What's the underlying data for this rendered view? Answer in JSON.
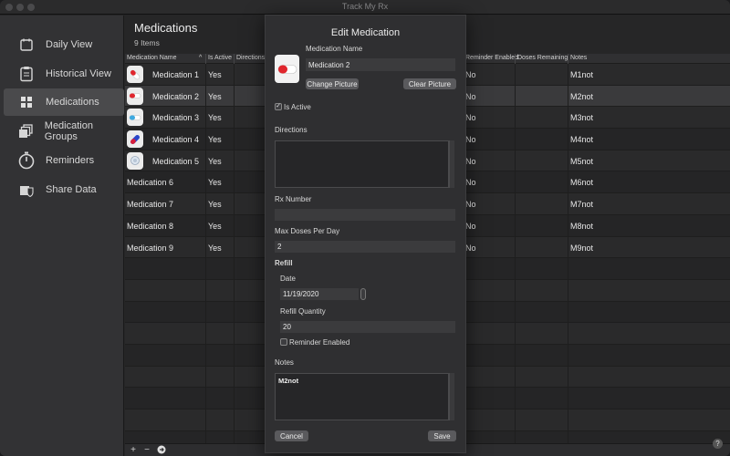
{
  "window": {
    "title": "Track My Rx"
  },
  "sidebar": {
    "items": [
      {
        "label": "Daily View",
        "icon": "calendar-icon",
        "active": false
      },
      {
        "label": "Historical View",
        "icon": "clipboard-icon",
        "active": false
      },
      {
        "label": "Medications",
        "icon": "grid-icon",
        "active": true
      },
      {
        "label": "Medication Groups",
        "icon": "stacked-squares-icon",
        "active": false
      },
      {
        "label": "Reminders",
        "icon": "stopwatch-icon",
        "active": false
      },
      {
        "label": "Share Data",
        "icon": "share-shield-icon",
        "active": false
      }
    ]
  },
  "main": {
    "title": "Medications",
    "count": "9 Items",
    "columns": {
      "name": "Medication Name",
      "sort": "^",
      "active": "Is Active",
      "directions": "Directions",
      "reminder": "Reminder Enabled",
      "doses": "Doses Remaining",
      "notes": "Notes"
    },
    "rows": [
      {
        "name": "Medication 1",
        "active": "Yes",
        "reminder": "No",
        "notes": "M1not",
        "pill": "red-white-capsule"
      },
      {
        "name": "Medication 2",
        "active": "Yes",
        "reminder": "No",
        "notes": "M2not",
        "pill": "red-white-pill"
      },
      {
        "name": "Medication 3",
        "active": "Yes",
        "reminder": "No",
        "notes": "M3not",
        "pill": "blue-white-pill"
      },
      {
        "name": "Medication 4",
        "active": "Yes",
        "reminder": "No",
        "notes": "M4not",
        "pill": "blue-red-capsule"
      },
      {
        "name": "Medication 5",
        "active": "Yes",
        "reminder": "No",
        "notes": "M5not",
        "pill": "round-tablet"
      },
      {
        "name": "Medication 6",
        "active": "Yes",
        "reminder": "No",
        "notes": "M6not"
      },
      {
        "name": "Medication 7",
        "active": "Yes",
        "reminder": "No",
        "notes": "M7not"
      },
      {
        "name": "Medication 8",
        "active": "Yes",
        "reminder": "No",
        "notes": "M8not"
      },
      {
        "name": "Medication 9",
        "active": "Yes",
        "reminder": "No",
        "notes": "M9not"
      }
    ],
    "bottom": {
      "add": "+",
      "remove": "−",
      "more": "●",
      "help": "?"
    }
  },
  "sheet": {
    "title": "Edit Medication",
    "name_label": "Medication Name",
    "name_value": "Medication 2",
    "change_picture": "Change Picture",
    "clear_picture": "Clear Picture",
    "is_active_label": "Is Active",
    "is_active_mark": "✓",
    "directions_label": "Directions",
    "directions_value": "",
    "rx_label": "Rx Number",
    "rx_value": "",
    "max_doses_label": "Max Doses Per Day",
    "max_doses_value": "2",
    "refill_label": "Refill",
    "date_label": "Date",
    "date_value": "11/19/2020",
    "refill_qty_label": "Refill Quantity",
    "refill_qty_value": "20",
    "reminder_label": "Reminder Enabled",
    "notes_label": "Notes",
    "notes_value": "M2not",
    "cancel": "Cancel",
    "save": "Save"
  },
  "colors": {
    "accent": "#4a4a4c",
    "pill_red": "#e0262d"
  }
}
